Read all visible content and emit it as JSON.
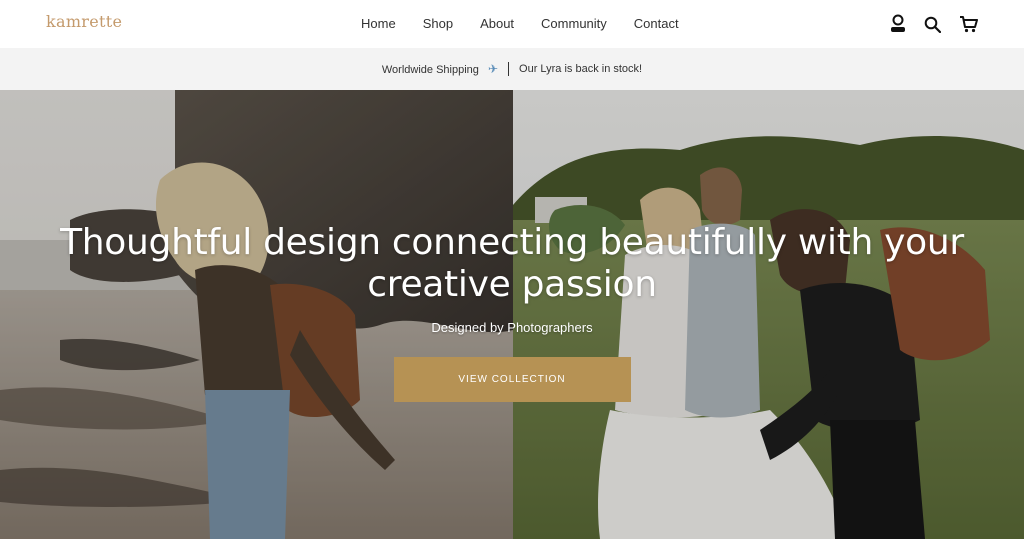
{
  "brand": {
    "logo_text": "kamrette",
    "accent": "#c49a6c"
  },
  "nav": {
    "items": [
      "Home",
      "Shop",
      "About",
      "Community",
      "Contact"
    ]
  },
  "header_icons": [
    "account-icon",
    "search-icon",
    "cart-icon"
  ],
  "announcement": {
    "left": "Worldwide Shipping",
    "right": "Our Lyra is back in stock!"
  },
  "hero": {
    "headline_line1": "Thoughtful design connecting beautifully with your",
    "headline_line2": "creative passion",
    "subtitle": "Designed by Photographers",
    "cta_label": "VIEW COLLECTION",
    "cta_color": "#b69254"
  }
}
